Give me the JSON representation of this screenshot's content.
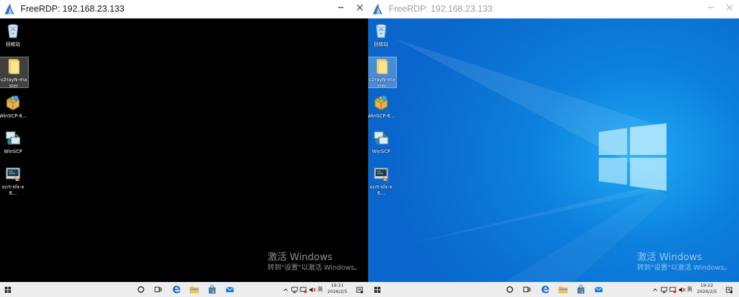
{
  "windows": [
    {
      "title": "FreeRDP: 192.168.23.133",
      "desktop_icons": [
        {
          "label": "回收站",
          "icon": "recycle-bin-icon"
        },
        {
          "label": "v2rayN-master",
          "icon": "folder-icon"
        },
        {
          "label": "WinSCP-6...",
          "icon": "winscp-installer-icon"
        },
        {
          "label": "WinSCP",
          "icon": "winscp-icon"
        },
        {
          "label": "scrt-sfx-x6...",
          "icon": "securecrt-installer-icon"
        }
      ],
      "watermark_line1": "激活 Windows",
      "watermark_line2": "转到\"设置\"以激活 Windows。",
      "ime": "英",
      "clock_time": "19:21",
      "clock_date": "2026/2/5"
    },
    {
      "title": "FreeRDP: 192.168.23.133",
      "desktop_icons": [
        {
          "label": "回收站",
          "icon": "recycle-bin-icon"
        },
        {
          "label": "v2rayN-master",
          "icon": "folder-icon"
        },
        {
          "label": "WinSCP-6...",
          "icon": "winscp-installer-icon"
        },
        {
          "label": "WinSCP",
          "icon": "winscp-icon"
        },
        {
          "label": "scrt-sfx-x6...",
          "icon": "securecrt-installer-icon"
        }
      ],
      "watermark_line1": "激活 Windows",
      "watermark_line2": "转到\"设置\"以激活 Windows。",
      "ime": "英",
      "clock_time": "19:22",
      "clock_date": "2026/2/5"
    }
  ],
  "colors": {
    "title_active": "#111111",
    "title_inactive": "#9aa0a6",
    "wallpaper_blue": "#0c7fdc",
    "taskbar": "#ededed",
    "edge_blue": "#1c6ed6"
  }
}
